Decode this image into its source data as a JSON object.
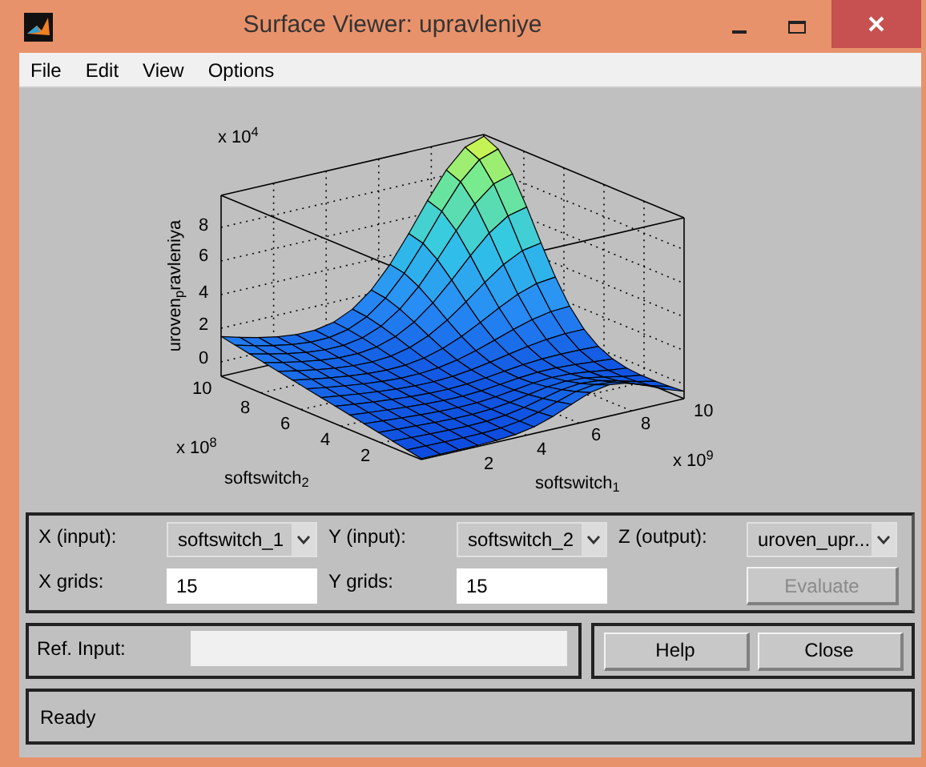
{
  "window": {
    "title": "Surface Viewer: upravleniye"
  },
  "menu": [
    "File",
    "Edit",
    "View",
    "Options"
  ],
  "plot": {
    "z_label": "uroven$_{p}$ravleniya",
    "z_multiplier": "x 10$^{4}$",
    "z_ticks": [
      "8",
      "6",
      "4",
      "2",
      "0"
    ],
    "y_label": "softswitch$_{2}$",
    "y_multiplier": "x 10$^{8}$",
    "y_ticks": [
      "10",
      "8",
      "6",
      "4",
      "2"
    ],
    "x_label": "softswitch$_{1}$",
    "x_multiplier": "x 10$^{9}$",
    "x_ticks": [
      "2",
      "4",
      "6",
      "8",
      "10"
    ]
  },
  "controls": {
    "x_input": {
      "label": "X (input):",
      "value": "softswitch_1"
    },
    "y_input": {
      "label": "Y (input):",
      "value": "softswitch_2"
    },
    "z_output": {
      "label": "Z (output):",
      "value": "uroven_upr..."
    },
    "x_grids": {
      "label": "X grids:",
      "value": "15"
    },
    "y_grids": {
      "label": "Y grids:",
      "value": "15"
    },
    "evaluate": {
      "label": "Evaluate",
      "disabled": true
    }
  },
  "ref_input": {
    "label": "Ref. Input:"
  },
  "buttons": [
    "Help",
    "Close"
  ],
  "status": "Ready"
}
